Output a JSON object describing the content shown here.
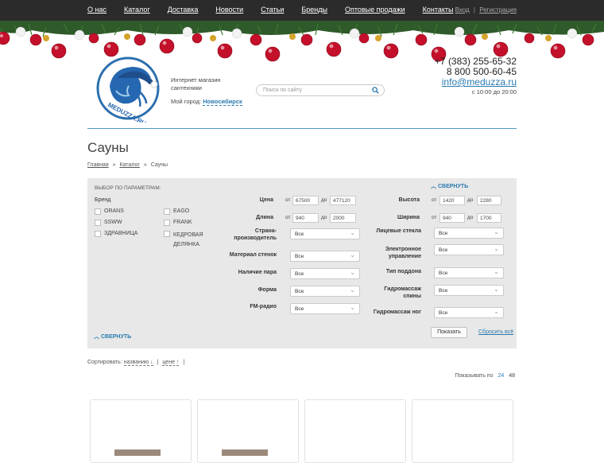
{
  "topnav": {
    "items": [
      "О нас",
      "Каталог",
      "Доставка",
      "Новости",
      "Статьи",
      "Бренды",
      "Оптовые продажи",
      "Контакты"
    ],
    "login": "Вход",
    "sep": "|",
    "register": "Регистрация"
  },
  "logo": {
    "text": "MEDUZZA.RU"
  },
  "shop": {
    "line1": "Интернет магазин",
    "line2": "сантехники",
    "city_label": "Мой город:",
    "city": "Новосибирск"
  },
  "search": {
    "placeholder": "Поиск по сайту"
  },
  "contacts": {
    "phone1": "+7 (383) 255-65-32",
    "phone2": "8 800 500-60-45",
    "email": "info@meduzza.ru",
    "hours": "с 10:00 до 20:00"
  },
  "page": {
    "title": "Сауны"
  },
  "breadcrumbs": {
    "home": "Главная",
    "catalog": "Каталог",
    "current": "Сауны",
    "sep": "»"
  },
  "filter": {
    "title": "ВЫБОР ПО ПАРАМЕТРАМ:",
    "collapse": "СВЕРНУТЬ",
    "brand_label": "Бренд",
    "brands": [
      "ORANS",
      "EAGO",
      "SSWW",
      "FRANK",
      "ЗДРАВНИЦА",
      "КЕДРОВАЯ ДЕЛЯНКА"
    ],
    "from": "от",
    "to": "до",
    "price": {
      "label": "Цена",
      "min": "67500",
      "max": "477120"
    },
    "length": {
      "label": "Длина",
      "min": "940",
      "max": "2000"
    },
    "height": {
      "label": "Высота",
      "min": "1420",
      "max": "2280"
    },
    "width": {
      "label": "Ширина",
      "min": "940",
      "max": "1700"
    },
    "selects_left": [
      {
        "label": "Страна-производитель",
        "value": "Все"
      },
      {
        "label": "Материал стенок",
        "value": "Все"
      },
      {
        "label": "Наличие пара",
        "value": "Все"
      },
      {
        "label": "Форма",
        "value": "Все"
      },
      {
        "label": "FM-радио",
        "value": "Все"
      }
    ],
    "selects_right": [
      {
        "label": "Лицевые стекла",
        "value": "Все"
      },
      {
        "label": "Электронное управление",
        "value": "Все"
      },
      {
        "label": "Тип поддона",
        "value": "Все"
      },
      {
        "label": "Гидромассаж спины",
        "value": "Все"
      },
      {
        "label": "Гидромассаж ног",
        "value": "Все"
      }
    ],
    "show_button": "Показать",
    "reset": "Сбросить всё"
  },
  "sort": {
    "label": "Сортировать:",
    "by_name": "названию ↓",
    "by_price": "цене ↑",
    "sep": "|"
  },
  "perpage": {
    "label": "Показывать по",
    "opt1": "24",
    "opt2": "48"
  },
  "colors": {
    "accent": "#2a7ab0",
    "topbar": "#2b2b2b",
    "filter_bg": "#e8e8e8"
  }
}
